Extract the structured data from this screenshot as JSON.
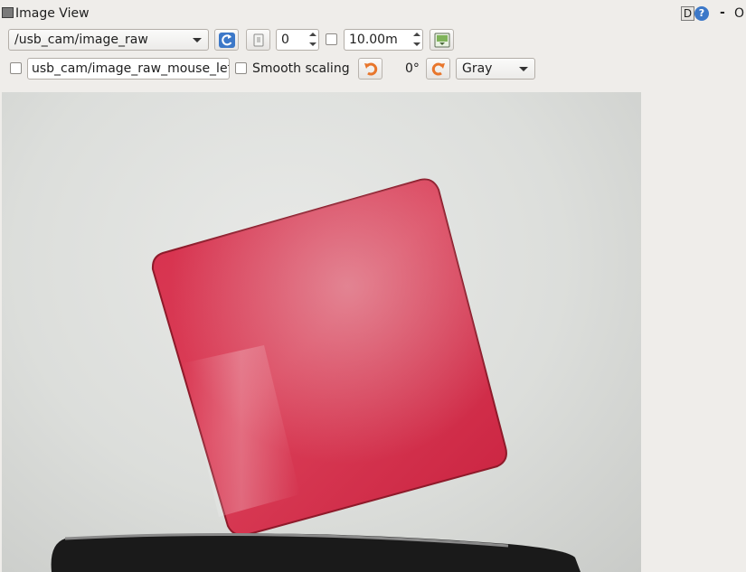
{
  "window": {
    "title": "Image View",
    "d_button": "D",
    "help_button": "?",
    "minimize_label": "-",
    "close_label": "O"
  },
  "toolbar_row1": {
    "topic_select": "/usb_cam/image_raw",
    "frame_spin_value": "0",
    "max_range_value": "10.00m"
  },
  "toolbar_row2": {
    "mouse_topic_value": "usb_cam/image_raw_mouse_left",
    "smooth_scaling_label": "Smooth scaling",
    "rotation_value": "0°",
    "color_scheme_select": "Gray"
  },
  "colors": {
    "accent_blue": "#3c78c8",
    "rotate_orange": "#e8762c",
    "object_red": "#d22a45"
  }
}
